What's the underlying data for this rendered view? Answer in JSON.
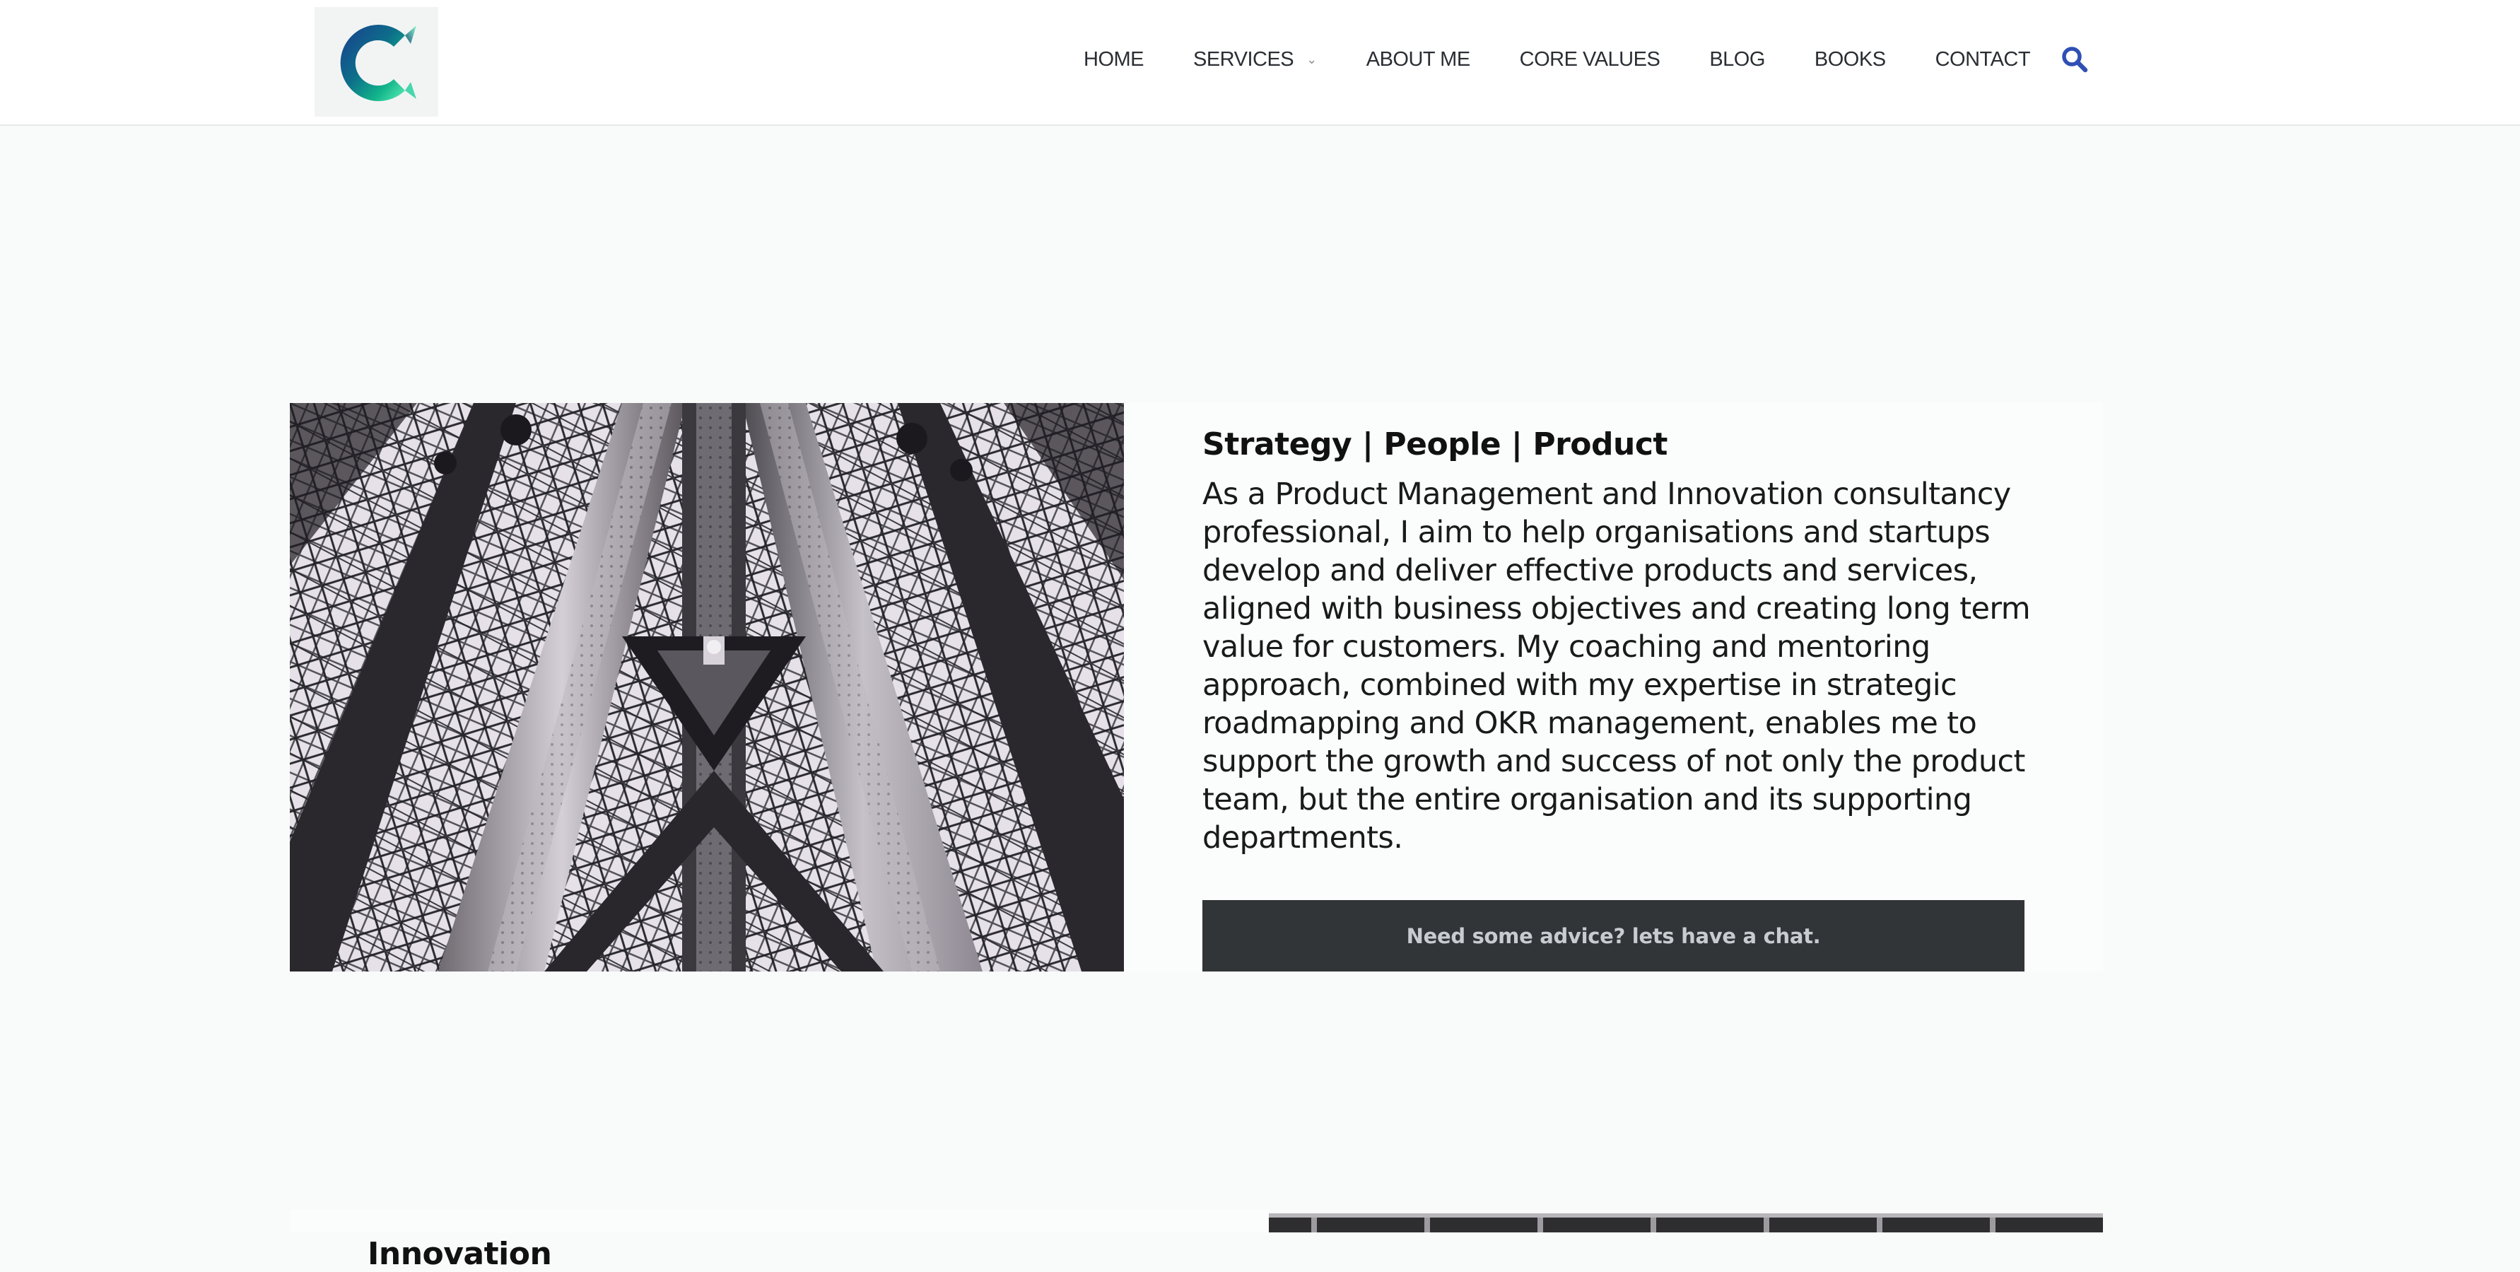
{
  "header": {
    "logo_alt": "C",
    "nav": {
      "home": "HOME",
      "services": "SERVICES",
      "about_me": "ABOUT ME",
      "core_values": "CORE VALUES",
      "blog": "BLOG",
      "books": "BOOKS",
      "contact": "CONTACT"
    },
    "services_chevron": "⌄",
    "search_icon": "search-icon"
  },
  "hero": {
    "heading": "Strategy | People | Product",
    "body": "As a Product Management and Innovation consultancy professional, I aim to help organisations and startups develop and deliver effective products and services, aligned with business objectives and creating long term value for customers. My coaching and mentoring approach, combined with my expertise in strategic roadmapping and OKR management, enables me to support the growth and success of not only the product team, but the entire organisation and its supporting departments.",
    "cta_label": "Need some advice? lets have a chat.",
    "image": "Eiffel tower steel lattice, black and white"
  },
  "next_section": {
    "heading": "Innovation"
  },
  "colors": {
    "accent": "#2f4fb5",
    "cta_background": "#323538",
    "page_background": "#f9fbfa"
  }
}
